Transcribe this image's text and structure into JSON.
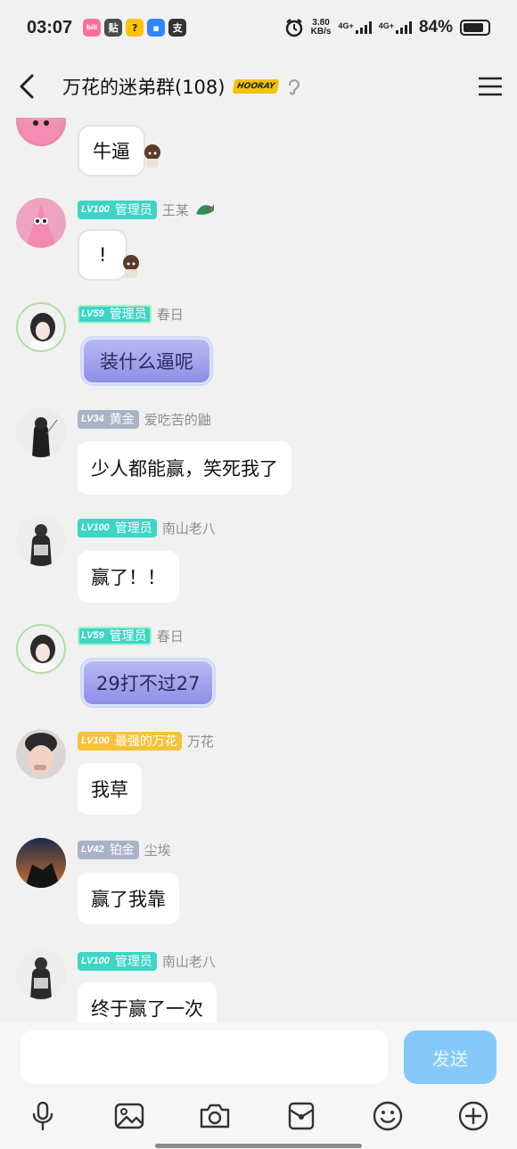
{
  "status_bar": {
    "time": "03:07",
    "apps": [
      {
        "icon": "bilibili-icon",
        "label": "bili",
        "color": "#fb7299"
      },
      {
        "icon": "tieba-icon",
        "label": "贴",
        "color": "#4a4a4a"
      },
      {
        "icon": "meituan-icon",
        "label": "?",
        "color": "#ffc300"
      },
      {
        "icon": "app-icon",
        "label": "▪",
        "color": "#2e86ff"
      },
      {
        "icon": "alipay-icon",
        "label": "支",
        "color": "#333333"
      }
    ],
    "speed_value": "3.80",
    "speed_unit": "KB/s",
    "network_1": "4G+",
    "network_2": "4G+",
    "battery": "84%",
    "battery_level": 0.84
  },
  "header": {
    "title": "万花的迷弟群(108)",
    "badge": "HOORAY"
  },
  "messages": [
    {
      "text": "牛逼",
      "style": "deco"
    },
    {
      "level": "LV100",
      "role": "管理员",
      "nick": "王某",
      "text": "!",
      "style": "deco"
    },
    {
      "level": "LV59",
      "role": "管理员",
      "nick": "春日",
      "text": "装什么逼呢",
      "style": "purple"
    },
    {
      "level": "LV34",
      "role": "黄金",
      "nick": "爱吃苦的鼬",
      "text": "少人都能赢，笑死我了",
      "style": "plain"
    },
    {
      "level": "LV100",
      "role": "管理员",
      "nick": "南山老八",
      "text": "赢了！！",
      "style": "brush"
    },
    {
      "level": "LV59",
      "role": "管理员",
      "nick": "春日",
      "text": "29打不过27",
      "style": "purple"
    },
    {
      "level": "LV100",
      "role": "最强的万花",
      "nick": "万花",
      "text": "我草",
      "style": "brush"
    },
    {
      "level": "LV42",
      "role": "铂金",
      "nick": "尘埃",
      "text": "赢了我靠",
      "style": "plain"
    },
    {
      "level": "LV100",
      "role": "管理员",
      "nick": "南山老八",
      "text": "终于赢了一次",
      "style": "brush"
    }
  ],
  "composer": {
    "placeholder": "",
    "send_label": "发送",
    "tools": [
      "microphone-icon",
      "image-icon",
      "camera-icon",
      "red-packet-icon",
      "emoji-icon",
      "plus-icon"
    ]
  },
  "colors": {
    "admin_badge": "#3cd5c6",
    "rank_badge": "#a9b3c7",
    "owner_badge": "#f7c23a",
    "send_button": "#86c9f9",
    "purple_bubble": "#9c9cec"
  }
}
